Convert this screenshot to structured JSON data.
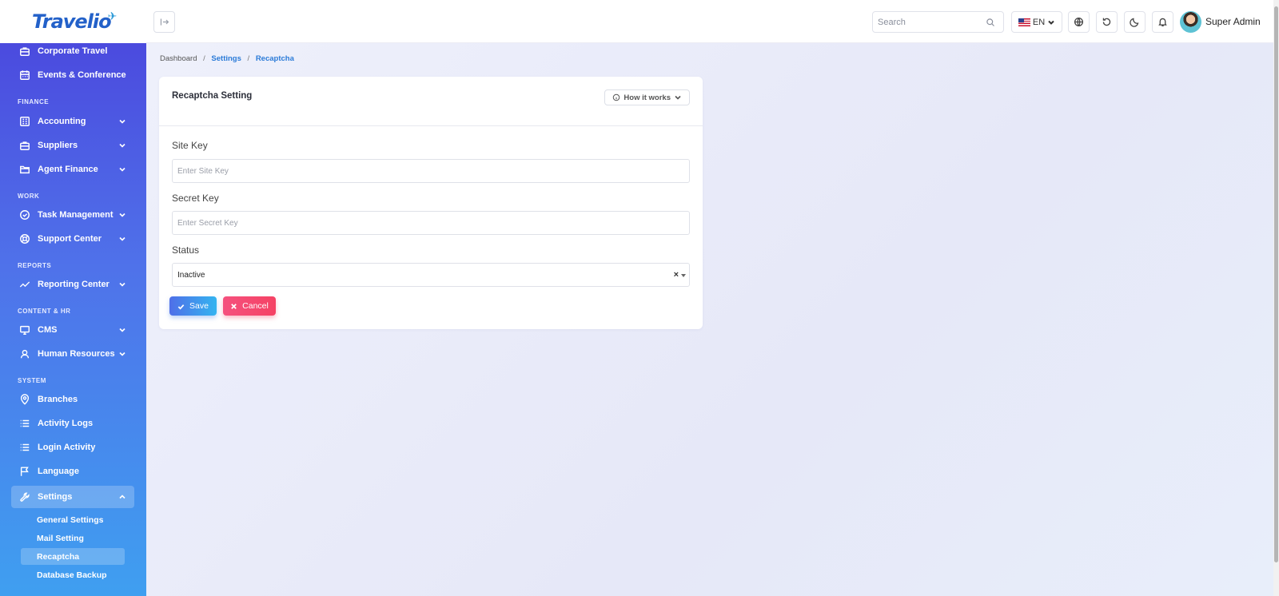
{
  "app": {
    "logo_text": "Travelio"
  },
  "header": {
    "search_placeholder": "Search",
    "language": "EN",
    "user_name": "Super Admin"
  },
  "sidebar": {
    "items_top": [
      {
        "label": "Corporate Travel",
        "icon": "briefcase-icon"
      },
      {
        "label": "Events & Conference",
        "icon": "calendar-icon"
      }
    ],
    "sections": {
      "finance": "FINANCE",
      "work": "WORK",
      "reports": "REPORTS",
      "content_hr": "CONTENT & HR",
      "system": "SYSTEM"
    },
    "finance_items": [
      {
        "label": "Accounting",
        "icon": "ledger-icon"
      },
      {
        "label": "Suppliers",
        "icon": "briefcase-icon"
      },
      {
        "label": "Agent Finance",
        "icon": "folder-icon"
      }
    ],
    "work_items": [
      {
        "label": "Task Management",
        "icon": "check-circle-icon"
      },
      {
        "label": "Support Center",
        "icon": "lifebuoy-icon"
      }
    ],
    "reports_items": [
      {
        "label": "Reporting Center",
        "icon": "trend-icon"
      }
    ],
    "content_items": [
      {
        "label": "CMS",
        "icon": "monitor-icon"
      },
      {
        "label": "Human Resources",
        "icon": "user-icon"
      }
    ],
    "system_items": [
      {
        "label": "Branches",
        "icon": "map-pin-icon"
      },
      {
        "label": "Activity Logs",
        "icon": "list-icon"
      },
      {
        "label": "Login Activity",
        "icon": "list-icon"
      },
      {
        "label": "Language",
        "icon": "flag-icon"
      },
      {
        "label": "Settings",
        "icon": "wrench-icon"
      }
    ],
    "settings_sub": [
      {
        "label": "General Settings"
      },
      {
        "label": "Mail Setting"
      },
      {
        "label": "Recaptcha"
      },
      {
        "label": "Database Backup"
      }
    ]
  },
  "breadcrumb": {
    "items": [
      "Dashboard",
      "Settings",
      "Recaptcha"
    ],
    "separator": "/"
  },
  "card": {
    "title": "Recaptcha Setting",
    "how_it_works": "How it works",
    "fields": {
      "site_key": {
        "label": "Site Key",
        "placeholder": "Enter Site Key",
        "value": ""
      },
      "secret_key": {
        "label": "Secret Key",
        "placeholder": "Enter Secret Key",
        "value": ""
      },
      "status": {
        "label": "Status",
        "value": "Inactive",
        "clear": "×"
      }
    },
    "save_label": "Save",
    "cancel_label": "Cancel"
  },
  "colors": {
    "sidebar_top": "#4a43dc",
    "sidebar_bottom": "#3f9ff0",
    "link": "#2b7bd8",
    "save_start": "#4f6fe8",
    "save_end": "#34b4f0",
    "cancel": "#f54264"
  }
}
